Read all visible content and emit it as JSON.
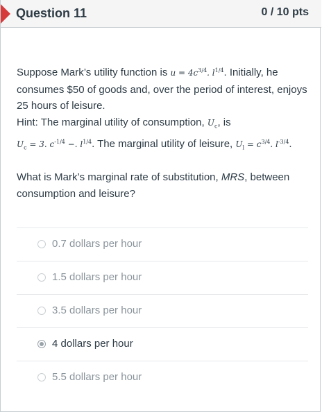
{
  "header": {
    "question_title": "Question 11",
    "points": "0 / 10 pts",
    "flag_color": "#d63a3a"
  },
  "question": {
    "p1_a": "Suppose Mark’s utility function is ",
    "utility_formula": "u = 4c",
    "utility_exp1": "3/4",
    "utility_mid": ". l",
    "utility_exp2": "1/4",
    "p1_b": ". Initially, he consumes $50 of goods and, over the period of interest, enjoys 25 hours of leisure.",
    "hint_a": "Hint: The marginal utility of consumption, ",
    "uc_symbol": "U",
    "uc_sub": "c",
    "hint_b": ", is",
    "uc_formula": "U",
    "uc_formula_sub": "c",
    "uc_formula_rest": " = 3. c",
    "uc_exp1": "-1/4",
    "uc_mid": " −. l",
    "uc_exp2": "1/4",
    "hint_c": ". The marginal utility of leisure, ",
    "ul_formula": "U",
    "ul_sub": "l",
    "ul_rest": " = c",
    "ul_exp1": "3/4",
    "ul_mid": ". l",
    "ul_exp2": "-3/4",
    "hint_end": ".",
    "prompt_a": "What is Mark’s marginal rate of substitution, ",
    "prompt_mrs": "MRS",
    "prompt_b": ", between consumption and leisure?"
  },
  "answers": [
    {
      "label": "0.7 dollars per hour",
      "selected": false
    },
    {
      "label": "1.5 dollars per hour",
      "selected": false
    },
    {
      "label": "3.5 dollars per hour",
      "selected": false
    },
    {
      "label": "4 dollars per hour",
      "selected": true
    },
    {
      "label": "5.5 dollars per hour",
      "selected": false
    }
  ]
}
